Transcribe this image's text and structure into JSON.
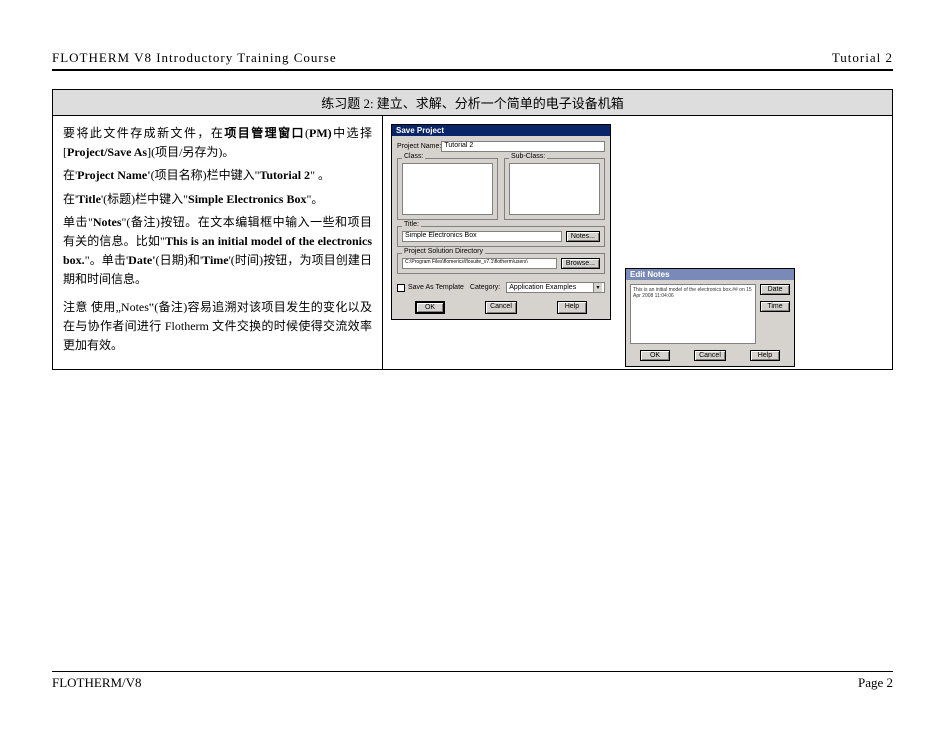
{
  "header": {
    "left": "FLOTHERM  V8  Introductory  Training  Course",
    "right": "Tutorial  2"
  },
  "box": {
    "title": "练习题 2: 建立、求解、分析一个简单的电子设备机箱",
    "p1_a": "要将此文件存成新文件，在",
    "p1_b": "项目管理窗口",
    "p1_c": "(",
    "p1_d": "PM)",
    "p1_e": "中选择[",
    "p1_f": "Project/Save As",
    "p1_g": "](项目/另存为)。",
    "p2_a": "在'",
    "p2_b": "Project  Name'",
    "p2_c": "(项目名称)栏中键入\"",
    "p2_d": "Tutorial 2",
    "p2_e": "\" 。",
    "p3_a": "在'",
    "p3_b": "Title",
    "p3_c": "'(标题)栏中键入\"",
    "p3_d": "Simple  Electronics  Box",
    "p3_e": "\"。",
    "p4_a": "单击\"",
    "p4_b": "Notes",
    "p4_c": "\"(备注)按钮。在文本编辑框中输入一些和项目有关的信息。比如\"",
    "p4_d": "This  is  an  initial  model  of the  electronics  box.",
    "p4_e": "\"。单击'",
    "p4_f": "Date'",
    "p4_g": "(日期)和'",
    "p4_h": "Time",
    "p4_i": "'(时间)按钮，为项目创建日期和时间信息。",
    "p5": "注意  使用„Notes‟(备注)容易追溯对该项目发生的变化以及在与协作者间进行 Flotherm 文件交换的时候使得交流效率更加有效。"
  },
  "saveDialog": {
    "title": "Save Project",
    "projectNameLabel": "Project Name:",
    "projectNameValue": "Tutorial 2",
    "classLabel": "Class:",
    "subClassLabel": "Sub-Class:",
    "titleLabel": "Title:",
    "titleValue": "Simple Electronics Box",
    "notesBtn": "Notes...",
    "dirLabel": "Project Solution Directory",
    "dirValue": "C:\\Program Files\\flomerics\\flosuite_v7.1\\flotherm\\users\\",
    "browseBtn": "Browse...",
    "saveTemplate": "Save As Template",
    "categoryLabel": "Category:",
    "categoryValue": "Application Examples",
    "okBtn": "OK",
    "cancelBtn": "Cancel",
    "helpBtn": "Help"
  },
  "notesDialog": {
    "title": "Edit Notes",
    "text": "This is an initial model of the electronics box.## on 15 Apr 2008 11:04:06",
    "dateBtn": "Date",
    "timeBtn": "Time",
    "okBtn": "OK",
    "cancelBtn": "Cancel",
    "helpBtn": "Help"
  },
  "footer": {
    "left": "FLOTHERM/V8",
    "right": "Page  2"
  }
}
